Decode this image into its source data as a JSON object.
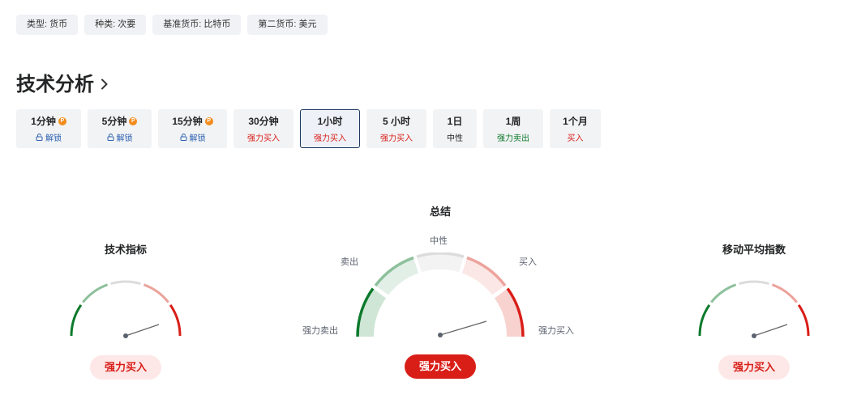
{
  "tags": [
    "类型: 货币",
    "种类: 次要",
    "基准货币: 比特币",
    "第二货币: 美元"
  ],
  "section_title": "技术分析",
  "timeframes": [
    {
      "label": "1分钟",
      "sub": "解锁",
      "locked": true
    },
    {
      "label": "5分钟",
      "sub": "解锁",
      "locked": true
    },
    {
      "label": "15分钟",
      "sub": "解锁",
      "locked": true
    },
    {
      "label": "30分钟",
      "sub": "强力买入",
      "locked": false
    },
    {
      "label": "1小时",
      "sub": "强力买入",
      "locked": false,
      "active": true
    },
    {
      "label": "5 小时",
      "sub": "强力买入",
      "locked": false
    },
    {
      "label": "1日",
      "sub": "中性",
      "locked": false
    },
    {
      "label": "1周",
      "sub": "强力卖出",
      "locked": false
    },
    {
      "label": "1个月",
      "sub": "买入",
      "locked": false
    }
  ],
  "pro_badge": "P",
  "gauges": {
    "indicators": {
      "title": "技术指标",
      "result": "强力买入"
    },
    "summary": {
      "title": "总结",
      "result": "强力买入",
      "labels": {
        "neutral": "中性",
        "sell": "卖出",
        "buy": "买入",
        "strong_sell": "强力卖出",
        "strong_buy": "强力买入"
      }
    },
    "moving_averages": {
      "title": "移动平均指数",
      "result": "强力买入"
    }
  },
  "colors": {
    "strong_sell": "#0c7a2b",
    "sell": "#8dc09c",
    "neutral": "#dcdcdc",
    "buy": "#eca39c",
    "strong_buy": "#d91e18",
    "active_border": "#1e3a5f",
    "pro": "#f28c1c"
  }
}
